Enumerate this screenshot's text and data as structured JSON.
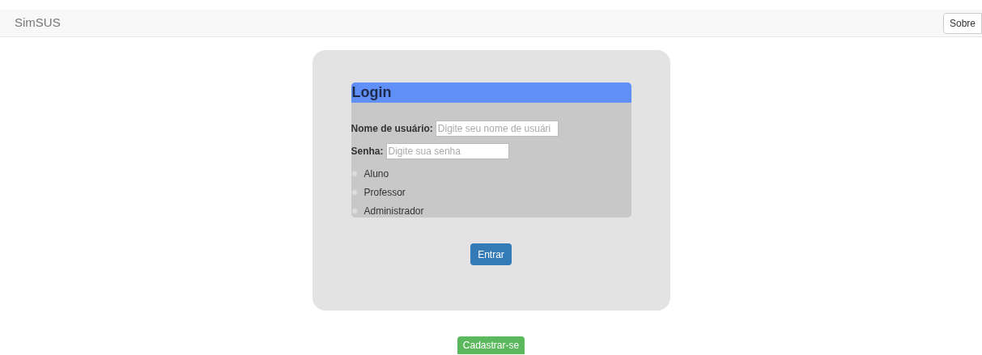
{
  "navbar": {
    "brand": "SimSUS",
    "button": "Sobre"
  },
  "login": {
    "title": "Login",
    "fields": [
      {
        "label": "Nome de usuário:",
        "placeholder": "Digite seu nome de usuári"
      },
      {
        "label": "Senha:",
        "placeholder": "Digite sua senha"
      }
    ],
    "roles": [
      {
        "label": "Aluno",
        "selected": false
      },
      {
        "label": "Professor",
        "selected": false
      },
      {
        "label": "Administrador",
        "selected": false
      }
    ],
    "submit": "Entrar"
  },
  "register": "Cadastrar-se"
}
